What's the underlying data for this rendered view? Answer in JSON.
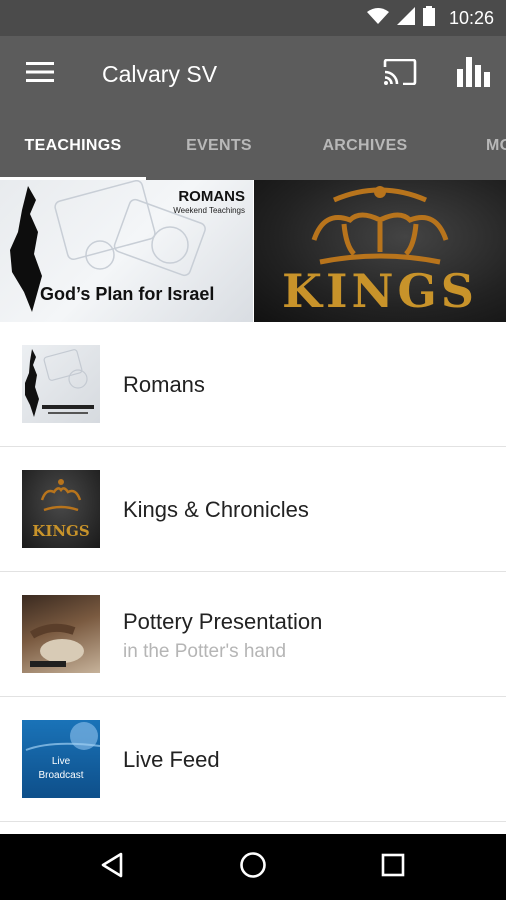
{
  "status_bar": {
    "time": "10:26"
  },
  "app_bar": {
    "title": "Calvary SV"
  },
  "tabs": [
    {
      "label": "TEACHINGS",
      "active": true
    },
    {
      "label": "EVENTS",
      "active": false
    },
    {
      "label": "ARCHIVES",
      "active": false
    },
    {
      "label": "MO",
      "active": false
    }
  ],
  "banners": {
    "romans": {
      "title": "ROMANS",
      "subtitle": "Weekend Teachings",
      "caption": "God’s Plan for Israel"
    },
    "kings": {
      "caption": "KINGS"
    }
  },
  "list": [
    {
      "title": "Romans",
      "subtitle": ""
    },
    {
      "title": "Kings & Chronicles",
      "subtitle": ""
    },
    {
      "title": "Pottery Presentation",
      "subtitle": "in the Potter's hand"
    },
    {
      "title": "Live Feed",
      "subtitle": ""
    }
  ],
  "thumbs": {
    "live_line1": "Live",
    "live_line2": "Broadcast",
    "kings_text": "KINGS"
  },
  "colors": {
    "toolbar": "#5c5c5c",
    "status_bar": "#4b4b4b",
    "active_tab": "#ffffff",
    "inactive_tab": "#b8b8b8",
    "subtitle": "#b5b5b5"
  }
}
